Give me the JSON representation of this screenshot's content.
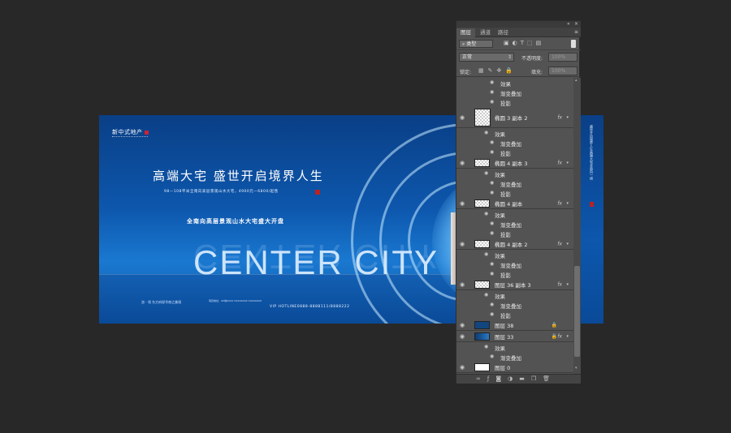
{
  "artwork": {
    "logo": "新中式地产",
    "headline": "高端大宅  盛世开启境界人生",
    "subline": "98—108平米全南向高层景观山水大宅，4900元—6800/起售",
    "tagline": "全南向高层景观山水大宅盛大开盘",
    "big_text": "CENTER CITY",
    "footer_left": "咨 · 领 东方府邸华商之美境",
    "footer_mid": "项目地址：XX地XXXX XXXXXXXX XXXXXXXX",
    "footer_hotline": "VIP HOTLINE0888-8888111/8888222",
    "side_vertical": "盛世开启境界人生高端大宅全南向一线"
  },
  "panel": {
    "tabs": [
      "图层",
      "通道",
      "路径"
    ],
    "active_tab": "图层",
    "filter": "类型",
    "filter_icons": [
      "image-filter-icon",
      "adjust-filter-icon",
      "text-filter-icon",
      "shape-filter-icon",
      "smart-filter-icon"
    ],
    "blend_mode": "正常",
    "opacity_label": "不透明度:",
    "opacity_value": "100%",
    "lock_label": "锁定:",
    "fill_label": "填充:",
    "fill_value": "100%",
    "effects_label": "效果",
    "gradient_overlay": "渐变叠加",
    "drop_shadow": "投影",
    "fx": "fx",
    "layers": [
      {
        "name": "椭圆 3 副本 2"
      },
      {
        "name": "椭圆 4 副本 3"
      },
      {
        "name": "椭圆 4 副本"
      },
      {
        "name": "椭圆 4 副本 2"
      },
      {
        "name": "图层 36 副本 3"
      },
      {
        "name": "图层 38"
      },
      {
        "name": "图层 33"
      },
      {
        "name": "图层 0"
      }
    ],
    "bottom_icons": [
      "link-icon",
      "fx-icon",
      "mask-icon",
      "adjustment-icon",
      "folder-icon",
      "new-layer-icon",
      "trash-icon"
    ]
  }
}
